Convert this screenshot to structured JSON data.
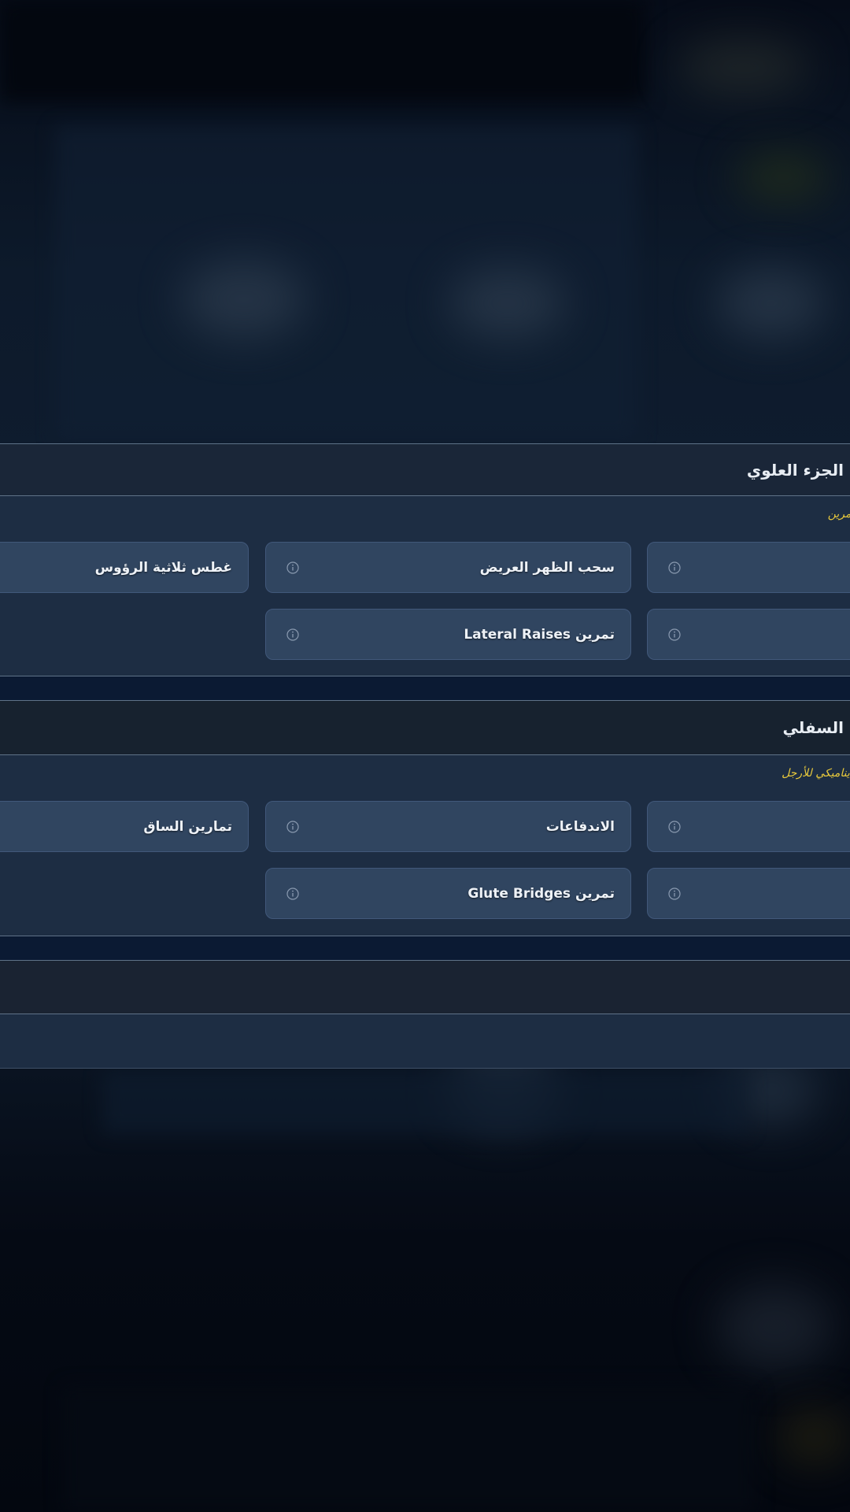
{
  "upper_body": {
    "title": "الجزء العلوي",
    "note": "تمرين",
    "exercises": [
      {
        "label": ""
      },
      {
        "label": "سحب الظهر العريض"
      },
      {
        "label": "غطس ثلاثية الرؤوس"
      },
      {
        "label": ""
      },
      {
        "label": "تمرين Lateral Raises"
      }
    ]
  },
  "lower_body": {
    "title": "السفلي",
    "note": "ديناميكي للأرجل",
    "exercises": [
      {
        "label": ""
      },
      {
        "label": "الاندفاعات"
      },
      {
        "label": "تمارين الساق"
      },
      {
        "label": ""
      },
      {
        "label": "تمرين Glute Bridges"
      }
    ]
  },
  "icons": {
    "info": "info-icon"
  },
  "colors": {
    "accent_note": "#e8c93c",
    "card": "#304560",
    "header": "#1a2638"
  }
}
